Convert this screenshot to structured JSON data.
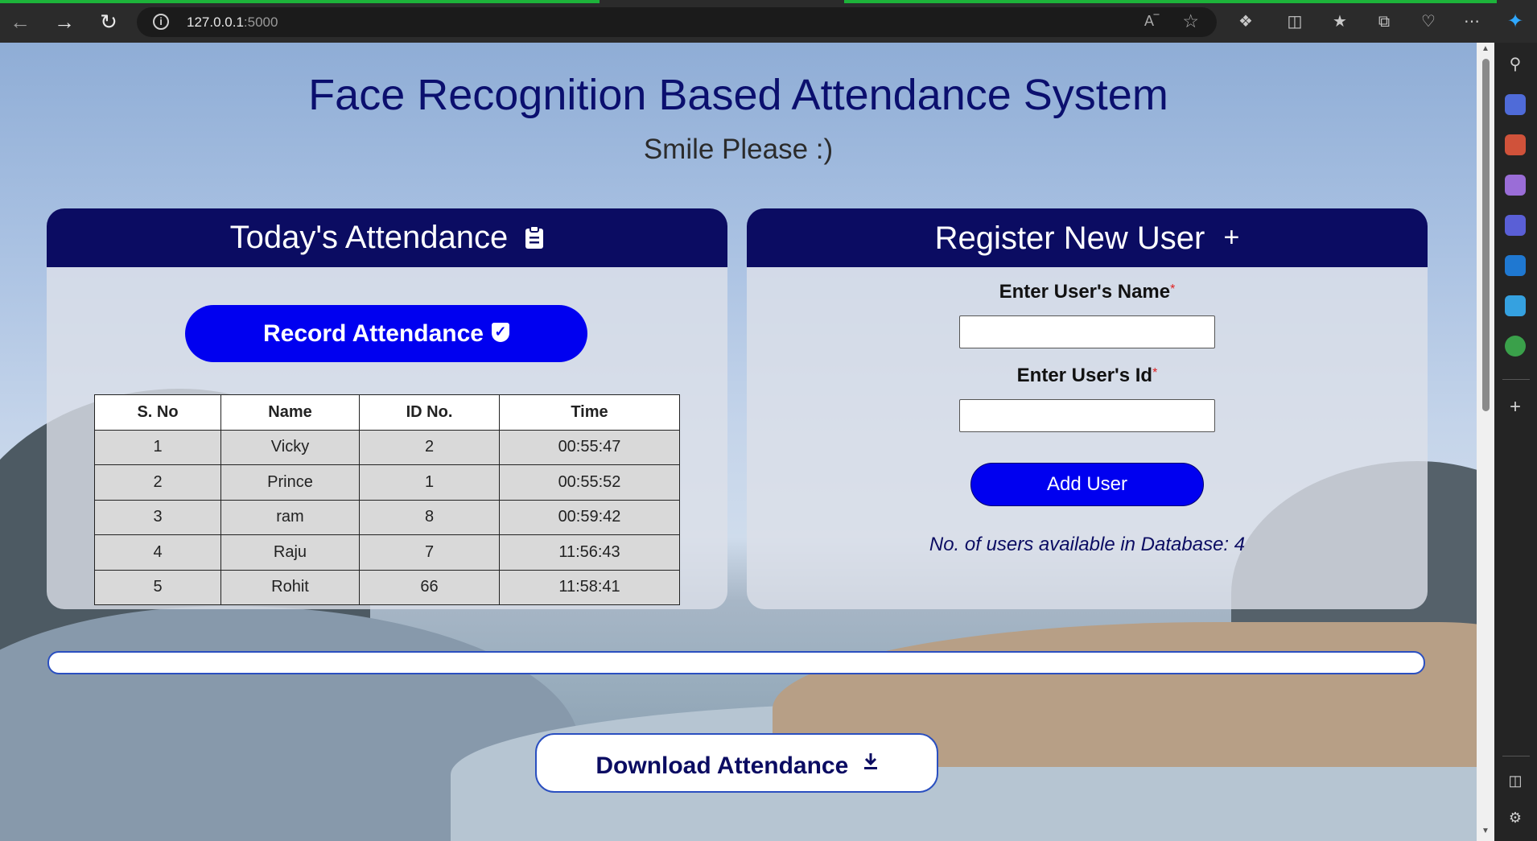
{
  "browser": {
    "url_host": "127.0.0.1",
    "url_port": ":5000",
    "read_aloud_label": "Aͅ"
  },
  "page": {
    "title": "Face Recognition Based Attendance System",
    "subtitle": "Smile Please :)"
  },
  "attendance_card": {
    "heading": "Today's Attendance",
    "record_button_label": "Record Attendance",
    "table": {
      "headers": [
        "S. No",
        "Name",
        "ID No.",
        "Time"
      ],
      "rows": [
        [
          "1",
          "Vicky",
          "2",
          "00:55:47"
        ],
        [
          "2",
          "Prince",
          "1",
          "00:55:52"
        ],
        [
          "3",
          "ram",
          "8",
          "00:59:42"
        ],
        [
          "4",
          "Raju",
          "7",
          "11:56:43"
        ],
        [
          "5",
          "Rohit",
          "66",
          "11:58:41"
        ]
      ]
    }
  },
  "register_card": {
    "heading": "Register New User",
    "name_label": "Enter User's Name",
    "name_value": "",
    "id_label": "Enter User's Id",
    "id_value": "",
    "required_mark": "*",
    "add_button_label": "Add User",
    "db_count_text": "No. of users available in Database: 4"
  },
  "progress": {
    "value": 0
  },
  "download_button_label": "Download Attendance",
  "colors": {
    "header_navy": "#0b0c62",
    "primary_blue": "#0000f0",
    "title_color": "#0b0f6e"
  },
  "icons": {
    "back": "arrow-left-icon",
    "forward": "arrow-right-icon",
    "refresh": "refresh-icon",
    "clipboard": "clipboard-icon",
    "plus": "plus-icon",
    "check": "check-shield-icon",
    "download": "download-icon"
  }
}
